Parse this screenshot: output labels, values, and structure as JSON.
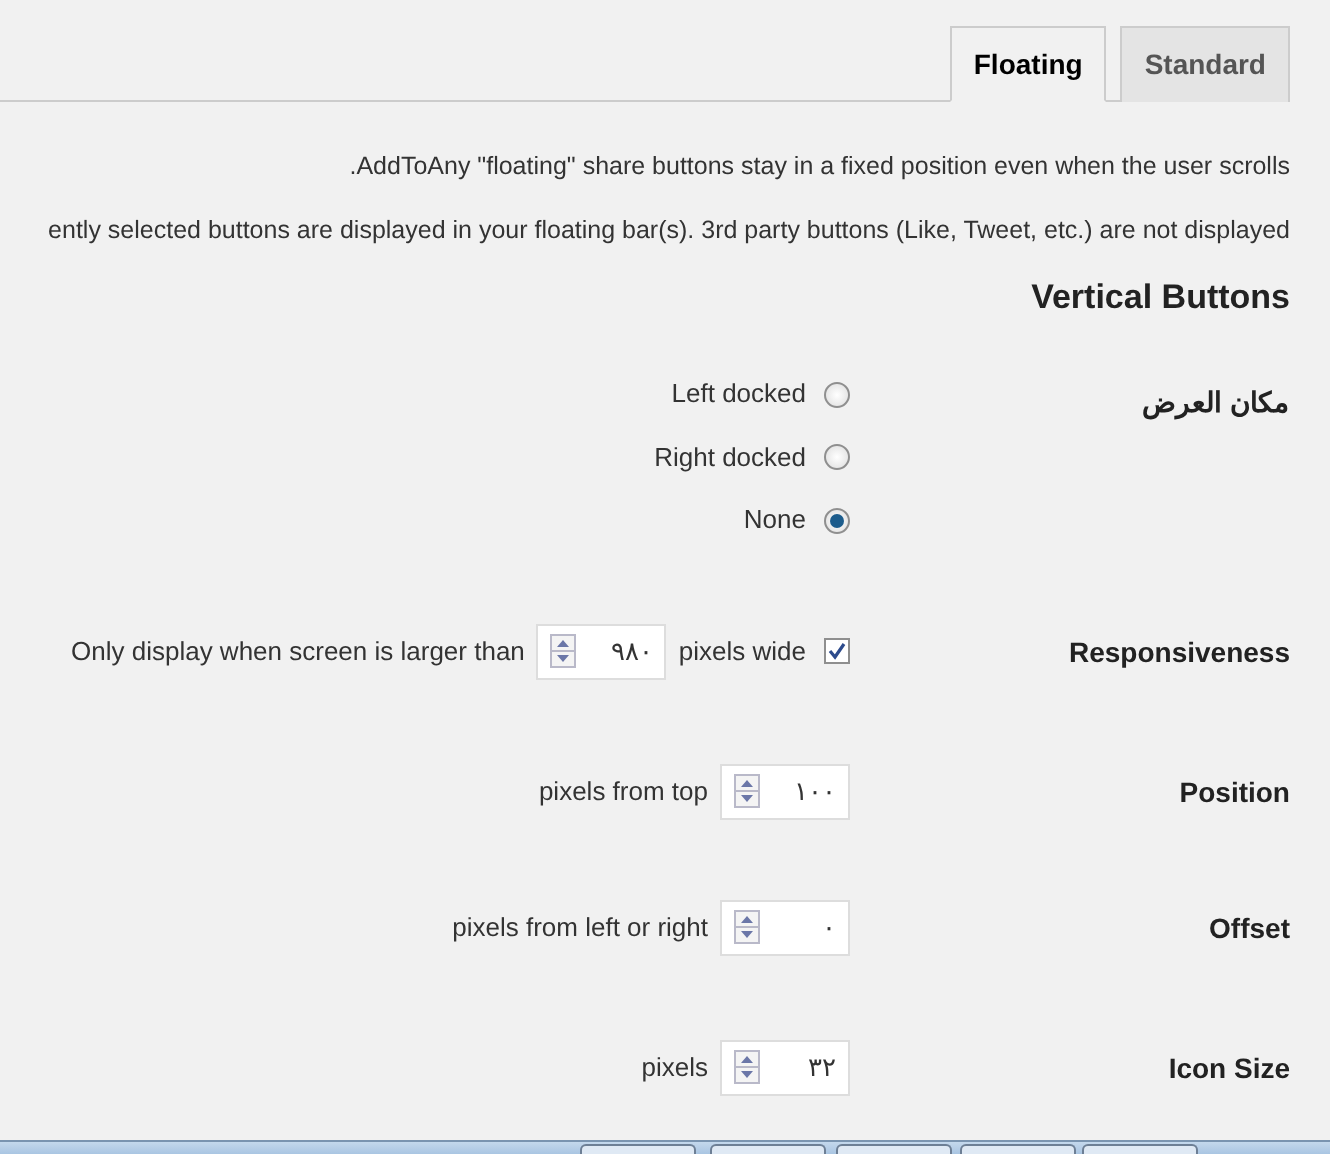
{
  "tabs": [
    {
      "label": "Floating",
      "selected": true
    },
    {
      "label": "Standard",
      "selected": false
    }
  ],
  "descriptions": [
    ".AddToAny \"floating\" share buttons stay in a fixed position even when the user scrolls",
    "ently selected buttons are displayed in your floating bar(s). 3rd party buttons (Like, Tweet, etc.) are not displayed"
  ],
  "section_title": "Vertical Buttons",
  "settings": [
    {
      "label": "مكان العرض",
      "kind": "radio",
      "options": [
        {
          "label": "Left docked",
          "selected": false
        },
        {
          "label": "Right docked",
          "selected": false
        },
        {
          "label": "None",
          "selected": true
        }
      ]
    },
    {
      "label": "Responsiveness",
      "kind": "checkbox",
      "checked": true,
      "text_before": "Only display when screen is larger than",
      "value": "٩٨٠",
      "text_after": "pixels wide"
    },
    {
      "label": "Position",
      "kind": "number",
      "text_before": "pixels from top",
      "value": "١٠٠"
    },
    {
      "label": "Offset",
      "kind": "number",
      "text_before": "pixels from left or right",
      "value": "٠"
    },
    {
      "label": "Icon Size",
      "kind": "number",
      "text_before": "pixels",
      "value": "٣٢"
    }
  ]
}
